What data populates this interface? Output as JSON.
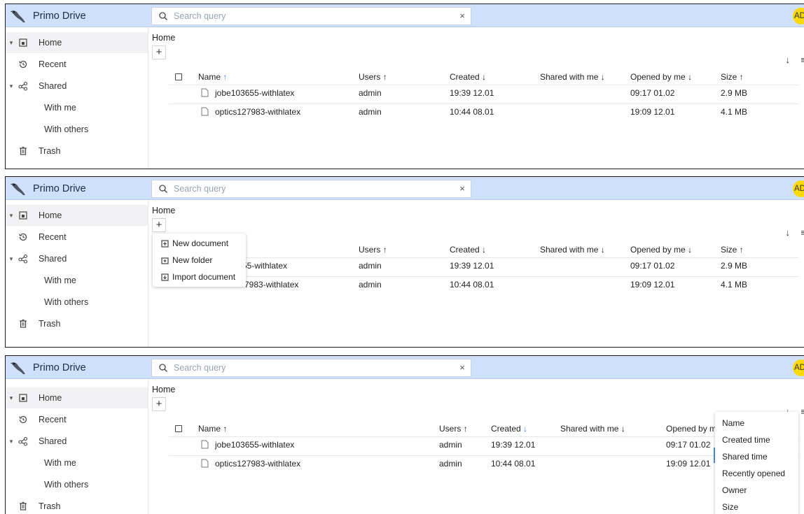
{
  "app": {
    "title": "Primo Drive"
  },
  "search": {
    "placeholder": "Search query",
    "clear": "×"
  },
  "user": {
    "initials": "AD"
  },
  "sidebar": {
    "items": [
      {
        "label": "Home"
      },
      {
        "label": "Recent"
      },
      {
        "label": "Shared"
      },
      {
        "label": "With me"
      },
      {
        "label": "With others"
      },
      {
        "label": "Trash"
      }
    ]
  },
  "content": {
    "breadcrumb": "Home",
    "new_button": "+",
    "sort_direction": "↓",
    "view_toggle": "≡"
  },
  "table": {
    "columns": [
      {
        "label": "Name",
        "arrow": "↑"
      },
      {
        "label": "Users",
        "arrow": "↑"
      },
      {
        "label": "Created",
        "arrow": "↓"
      },
      {
        "label": "Shared with me",
        "arrow": "↓"
      },
      {
        "label": "Opened by me",
        "arrow": "↓"
      },
      {
        "label": "Size",
        "arrow": "↑"
      }
    ],
    "rows": [
      {
        "name": "jobe103655-withlatex",
        "users": "admin",
        "created": "19:39 12.01",
        "opened": "09:17 01.02",
        "size": "2.9 MB"
      },
      {
        "name": "optics127983-withlatex",
        "users": "admin",
        "created": "10:44 08.01",
        "opened": "19:09 12.01",
        "size": "4.1 MB"
      }
    ],
    "partial": {
      "name_new_doc": "55-withlatex",
      "name_import": "7983-withlatex",
      "opened_header": "Opened by me"
    }
  },
  "new_menu": {
    "items": [
      "New document",
      "New folder",
      "Import document"
    ]
  },
  "sort_menu": {
    "items": [
      "Name",
      "Created time",
      "Shared time",
      "Recently opened",
      "Owner",
      "Size"
    ]
  },
  "colors": {
    "topbar": "#cfe0fb",
    "accent": "#4a7fe0",
    "avatar": "#fbd80a"
  }
}
